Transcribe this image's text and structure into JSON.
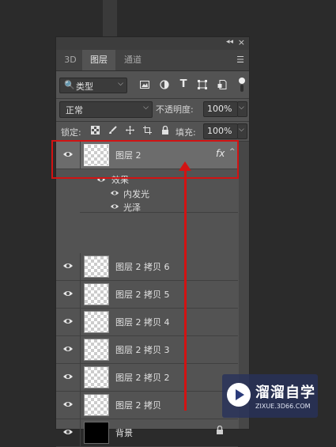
{
  "panel": {
    "collapse_glyph": "◂◂",
    "close_glyph": "×",
    "tabs": [
      {
        "label": "3D"
      },
      {
        "label": "图层"
      },
      {
        "label": "通道"
      }
    ],
    "menu_glyph": "☰"
  },
  "filter": {
    "search_glyph": "🔍",
    "label": "类型",
    "arrow": "⌵",
    "icons": [
      "image-filter-icon",
      "adjustment-filter-icon",
      "type-filter-icon",
      "shape-filter-icon",
      "smartobject-filter-icon"
    ],
    "type_glyph": "T"
  },
  "blend": {
    "mode": "正常",
    "arrow": "⌵",
    "opacity_label": "不透明度:",
    "opacity_value": "100%"
  },
  "lock": {
    "label": "锁定:",
    "fill_label": "填充:",
    "fill_value": "100%"
  },
  "layers": [
    {
      "name": "图层 2",
      "selected": true,
      "fx": "fx"
    },
    {
      "name": "图层 2 拷贝 6"
    },
    {
      "name": "图层 2 拷贝 5"
    },
    {
      "name": "图层 2 拷贝 4"
    },
    {
      "name": "图层 2 拷贝 3"
    },
    {
      "name": "图层 2 拷贝 2"
    },
    {
      "name": "图层 2 拷贝"
    },
    {
      "name": "背景",
      "locked": true
    }
  ],
  "effects": {
    "header": "效果",
    "items": [
      "内发光",
      "光泽"
    ]
  },
  "watermark": {
    "title": "溜溜自学",
    "url": "ZIXUE.3D66.COM"
  },
  "colors": {
    "highlight": "#d21313",
    "panel_bg": "#535353",
    "selected_row": "#6c6c6c"
  }
}
